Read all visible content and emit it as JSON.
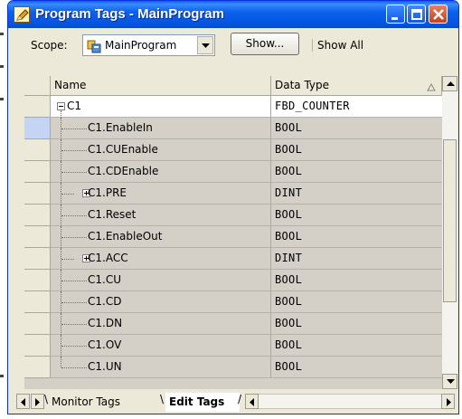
{
  "window": {
    "title": "Program Tags - MainProgram",
    "title_icon": "pencil-icon",
    "buttons": [
      "minimize",
      "maximize",
      "close"
    ]
  },
  "scope": {
    "label": "Scope:",
    "value": "MainProgram",
    "icon": "program-icon",
    "show_button": "Show...",
    "show_all": "Show All"
  },
  "grid": {
    "columns": {
      "name": "Name",
      "data_type": "Data Type"
    },
    "rows": [
      {
        "name": "C1",
        "type": "FBD_COUNTER",
        "level": 0,
        "expander": "minus"
      },
      {
        "name": "C1.EnableIn",
        "type": "BOOL",
        "level": 1,
        "expander": "",
        "selected": true
      },
      {
        "name": "C1.CUEnable",
        "type": "BOOL",
        "level": 1,
        "expander": ""
      },
      {
        "name": "C1.CDEnable",
        "type": "BOOL",
        "level": 1,
        "expander": ""
      },
      {
        "name": "C1.PRE",
        "type": "DINT",
        "level": 1,
        "expander": "plus"
      },
      {
        "name": "C1.Reset",
        "type": "BOOL",
        "level": 1,
        "expander": ""
      },
      {
        "name": "C1.EnableOut",
        "type": "BOOL",
        "level": 1,
        "expander": ""
      },
      {
        "name": "C1.ACC",
        "type": "DINT",
        "level": 1,
        "expander": "plus"
      },
      {
        "name": "C1.CU",
        "type": "BOOL",
        "level": 1,
        "expander": ""
      },
      {
        "name": "C1.CD",
        "type": "BOOL",
        "level": 1,
        "expander": ""
      },
      {
        "name": "C1.DN",
        "type": "BOOL",
        "level": 1,
        "expander": ""
      },
      {
        "name": "C1.OV",
        "type": "BOOL",
        "level": 1,
        "expander": ""
      },
      {
        "name": "C1.UN",
        "type": "BOOL",
        "level": 1,
        "expander": ""
      }
    ]
  },
  "tabs": {
    "monitor": "Monitor Tags",
    "edit": "Edit Tags"
  },
  "colors": {
    "titlebar": "#0554e2",
    "window_bg": "#ece9d8",
    "child_row_bg": "#d4d0c8",
    "parent_row_bg": "#ffffff"
  }
}
